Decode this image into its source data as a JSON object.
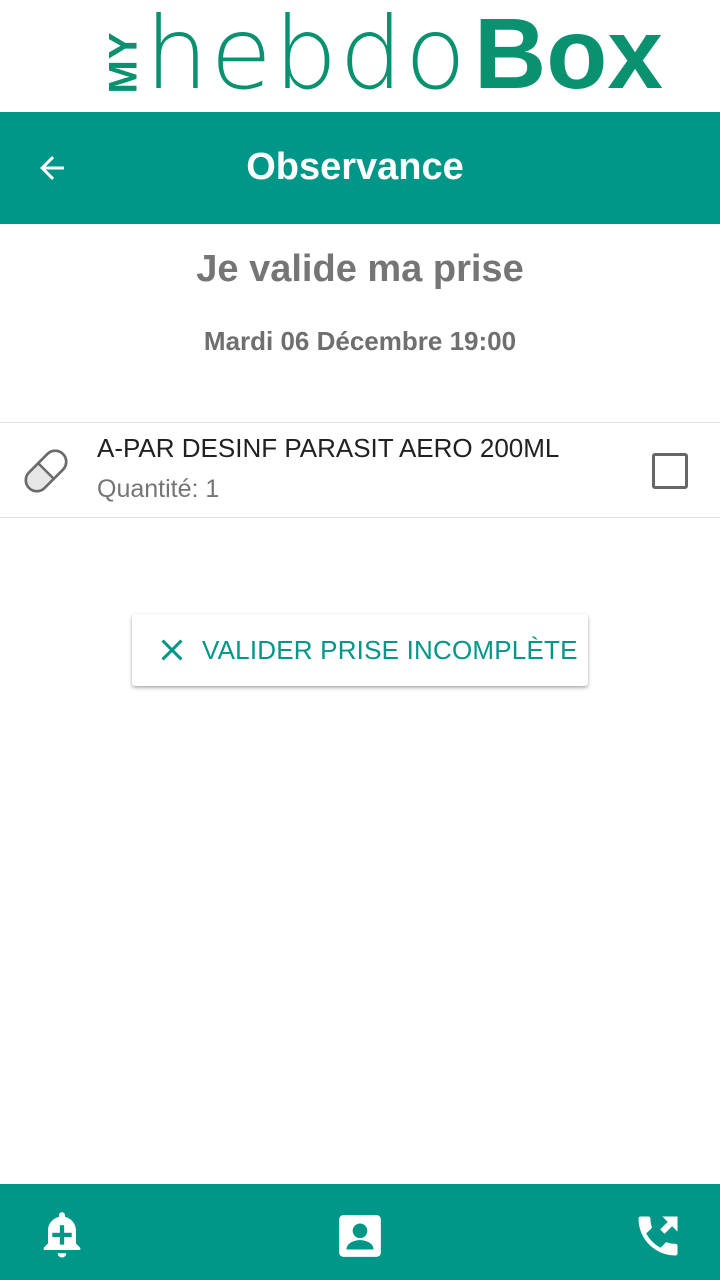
{
  "brand": {
    "my": "MY",
    "hebdo": "hebdo",
    "box": "Box",
    "color": "#0a9170"
  },
  "appbar": {
    "title": "Observance",
    "back_icon": "arrow-left-icon",
    "color": "#009688"
  },
  "page": {
    "heading": "Je valide ma prise",
    "datetime": "Mardi 06 Décembre 19:00"
  },
  "medications": [
    {
      "name": "A-PAR DESINF PARASIT AERO 200ML",
      "quantity": "Quantité: 1",
      "icon": "pill-icon",
      "checked": false
    }
  ],
  "actions": {
    "validate_incomplete": "VALIDER PRISE INCOMPLÈTE",
    "icon": "close-icon"
  },
  "bottom_nav": {
    "items": [
      {
        "name": "reminders",
        "icon": "bell-plus-icon"
      },
      {
        "name": "profile",
        "icon": "contact-card-icon"
      },
      {
        "name": "calls",
        "icon": "phone-forward-icon"
      }
    ]
  }
}
